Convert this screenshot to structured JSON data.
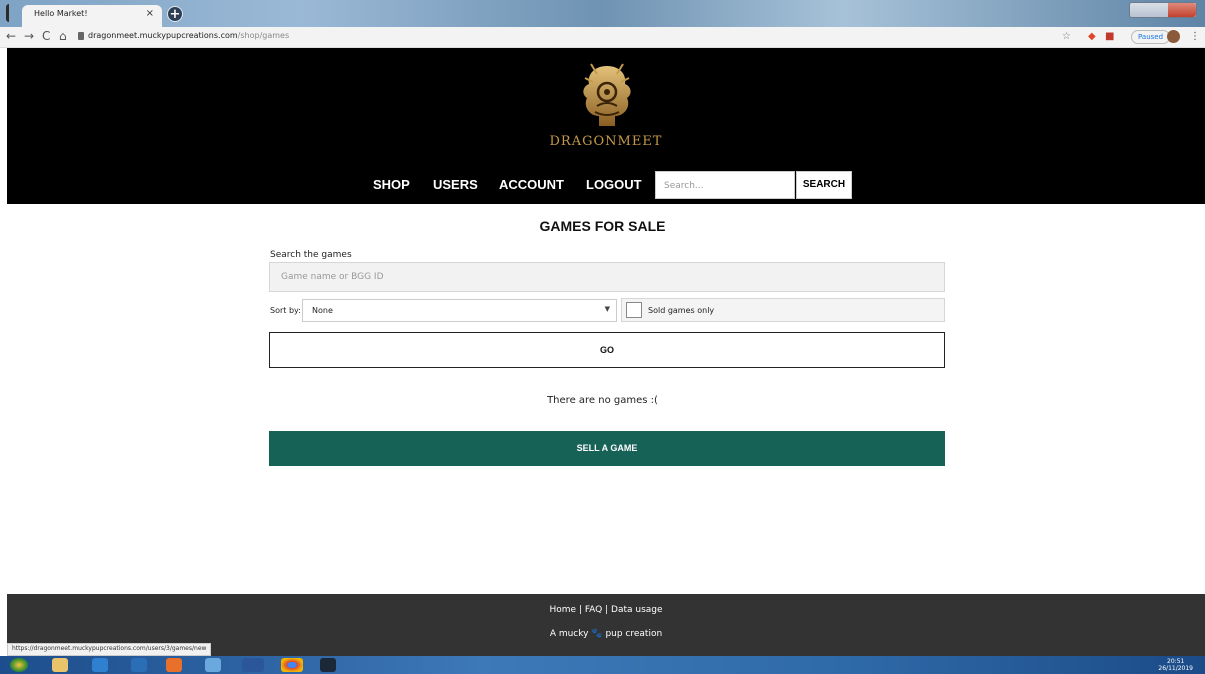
{
  "browser": {
    "tab_title": "Hello Market!",
    "tab_close": "×",
    "new_tab": "+",
    "back": "←",
    "forward": "→",
    "reload": "C",
    "home": "⌂",
    "url_host": "dragonmeet.muckypupcreations.com",
    "url_path": "/shop/games",
    "star": "☆",
    "menu": "⋮",
    "profile_status": "Paused",
    "status_url": "https://dragonmeet.muckypupcreations.com/users/3/games/new"
  },
  "header": {
    "brand": "DRAGONMEET",
    "nav": [
      "SHOP",
      "USERS",
      "ACCOUNT",
      "LOGOUT"
    ],
    "search_placeholder": "Search...",
    "search_button": "SEARCH"
  },
  "main": {
    "title": "GAMES FOR SALE",
    "search_label": "Search the games",
    "search_placeholder": "Game name or BGG ID",
    "sort_label": "Sort by:",
    "sort_value": "None",
    "sort_arrow": "▼",
    "sold_label": "Sold games only",
    "go_button": "GO",
    "empty_message": "There are no games :(",
    "sell_button": "SELL A GAME"
  },
  "footer": {
    "links": [
      "Home",
      "FAQ",
      "Data usage"
    ],
    "separator": "|",
    "credit_prefix": "A mucky",
    "credit_suffix": "pup creation"
  },
  "taskbar": {
    "time": "20:51",
    "date": "26/11/2019"
  },
  "colors": {
    "header_bg": "#000000",
    "brand_gold": "#c49a4a",
    "sell_button": "#176257",
    "footer_bg": "#333333"
  }
}
